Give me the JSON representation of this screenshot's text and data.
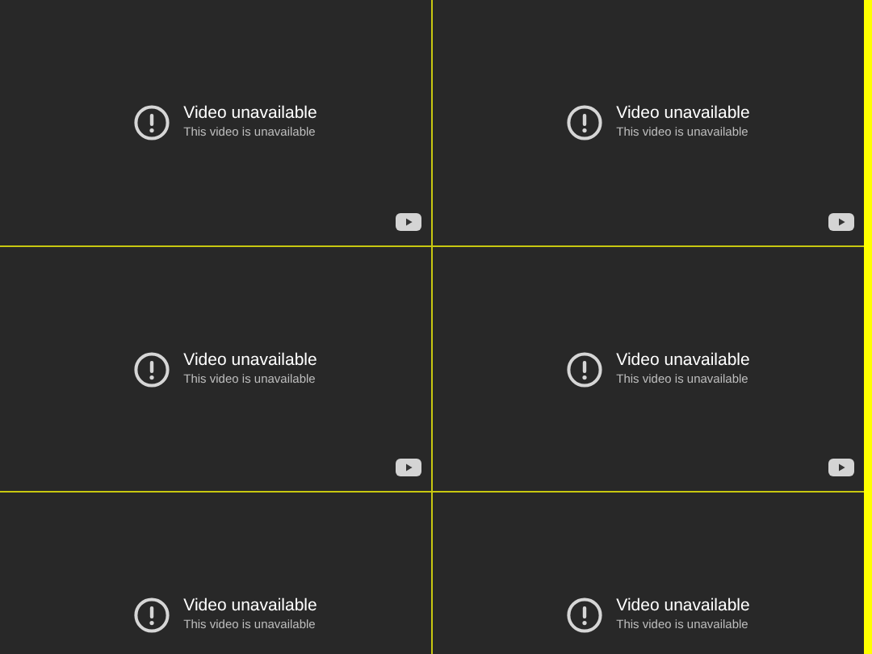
{
  "videos": [
    {
      "title": "Video unavailable",
      "message": "This video is unavailable",
      "play_badge": true
    },
    {
      "title": "Video unavailable",
      "message": "This video is unavailable",
      "play_badge": true
    },
    {
      "title": "Video unavailable",
      "message": "This video is unavailable",
      "play_badge": true
    },
    {
      "title": "Video unavailable",
      "message": "This video is unavailable",
      "play_badge": true
    },
    {
      "title": "Video unavailable",
      "message": "This video is unavailable",
      "play_badge": false
    },
    {
      "title": "Video unavailable",
      "message": "This video is unavailable",
      "play_badge": false
    }
  ]
}
